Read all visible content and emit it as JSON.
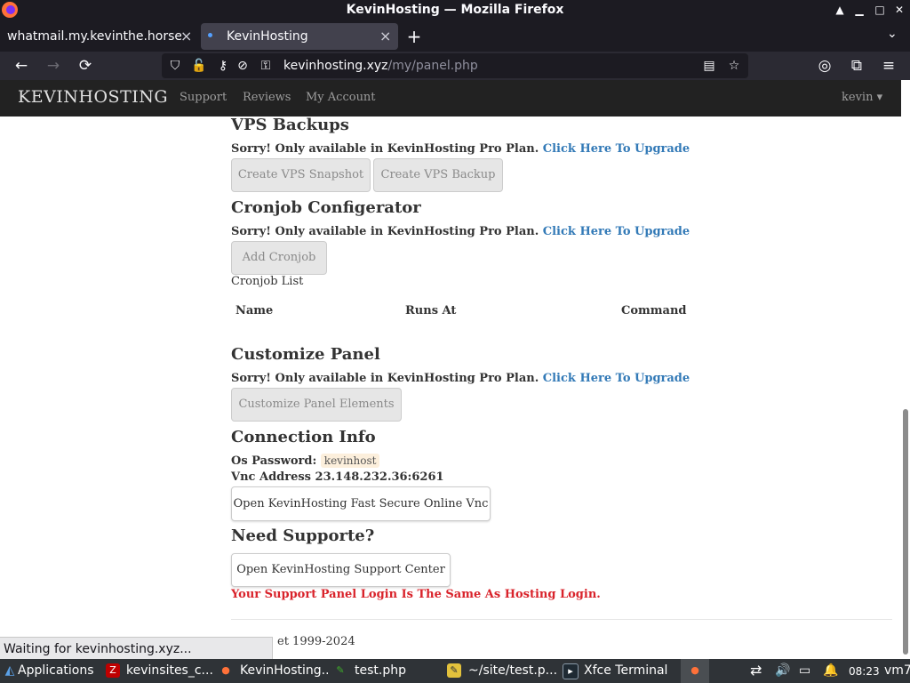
{
  "window": {
    "title": "KevinHosting — Mozilla Firefox",
    "minimize_glyph": "▁",
    "maximize_glyph": "□",
    "close_glyph": "✕",
    "collapse_glyph": "▲"
  },
  "tabs": [
    {
      "label": "whatmail.my.kevinthe.horse/",
      "close": "×"
    },
    {
      "label": "KevinHosting",
      "close": "×"
    }
  ],
  "newtab_glyph": "+",
  "tablist_glyph": "⌄",
  "toolbar": {
    "back": "←",
    "forward": "→",
    "reload": "⟳",
    "url_host": "kevinhosting.xyz",
    "url_path": "/my/panel.php",
    "reader_icon": "reader-view-icon",
    "bookmark": "☆",
    "account": "◎",
    "extensions": "⧉",
    "menu": "≡"
  },
  "site": {
    "brand": "KEVINHOSTING",
    "nav": [
      "Support",
      "Reviews",
      "My Account"
    ],
    "user": "kevin ▾"
  },
  "sections": {
    "vps_backups": {
      "title": "VPS Backups",
      "sorry": "Sorry! Only available in KevinHosting Pro Plan.",
      "upgrade": "Click Here To Upgrade",
      "btn_snapshot": "Create VPS Snapshot",
      "btn_backup": "Create VPS Backup"
    },
    "cronjob": {
      "title": "Cronjob Configerator",
      "sorry": "Sorry! Only available in KevinHosting Pro Plan.",
      "upgrade": "Click Here To Upgrade",
      "btn_add": "Add Cronjob",
      "list_label": "Cronjob List",
      "columns": [
        "Name",
        "Runs At",
        "Command"
      ]
    },
    "customize": {
      "title": "Customize Panel",
      "sorry": "Sorry! Only available in KevinHosting Pro Plan.",
      "upgrade": "Click Here To Upgrade",
      "btn": "Customize Panel Elements"
    },
    "connection": {
      "title": "Connection Info",
      "os_label": "Os Password:",
      "os_value": "kevinhost",
      "vnc": "Vnc Address 23.148.232.36:6261",
      "btn": "Open KevinHosting Fast Secure Online Vnc"
    },
    "support": {
      "title": "Need Supporte?",
      "btn": "Open KevinHosting Support Center",
      "warning": "Your Support Panel Login Is The Same As Hosting Login."
    },
    "footer": "et 1999-2024"
  },
  "status_text": "Waiting for kevinhosting.xyz...",
  "taskbar": {
    "apps": "Applications",
    "items": [
      {
        "label": "kevinsites_c...",
        "icon": "filezilla-icon",
        "glyph": "Z",
        "color": "#bf0000"
      },
      {
        "label": "KevinHosting...",
        "icon": "firefox-icon",
        "glyph": "●",
        "color": "#ff7139"
      },
      {
        "label": "test.php",
        "icon": "editor-icon",
        "glyph": "✎",
        "color": "#3fae2a"
      },
      {
        "label": "~/site/test.p...",
        "icon": "mousepad-icon",
        "glyph": "✎",
        "color": "#e3c23c"
      },
      {
        "label": "Xfce Terminal",
        "icon": "terminal-icon",
        "glyph": "▸",
        "color": "#1f2a33"
      }
    ],
    "clock": "08:23",
    "host": "vm7"
  },
  "colors": {
    "link": "#337ab7",
    "warning": "#d9232b",
    "navbar_bg": "#222222"
  }
}
